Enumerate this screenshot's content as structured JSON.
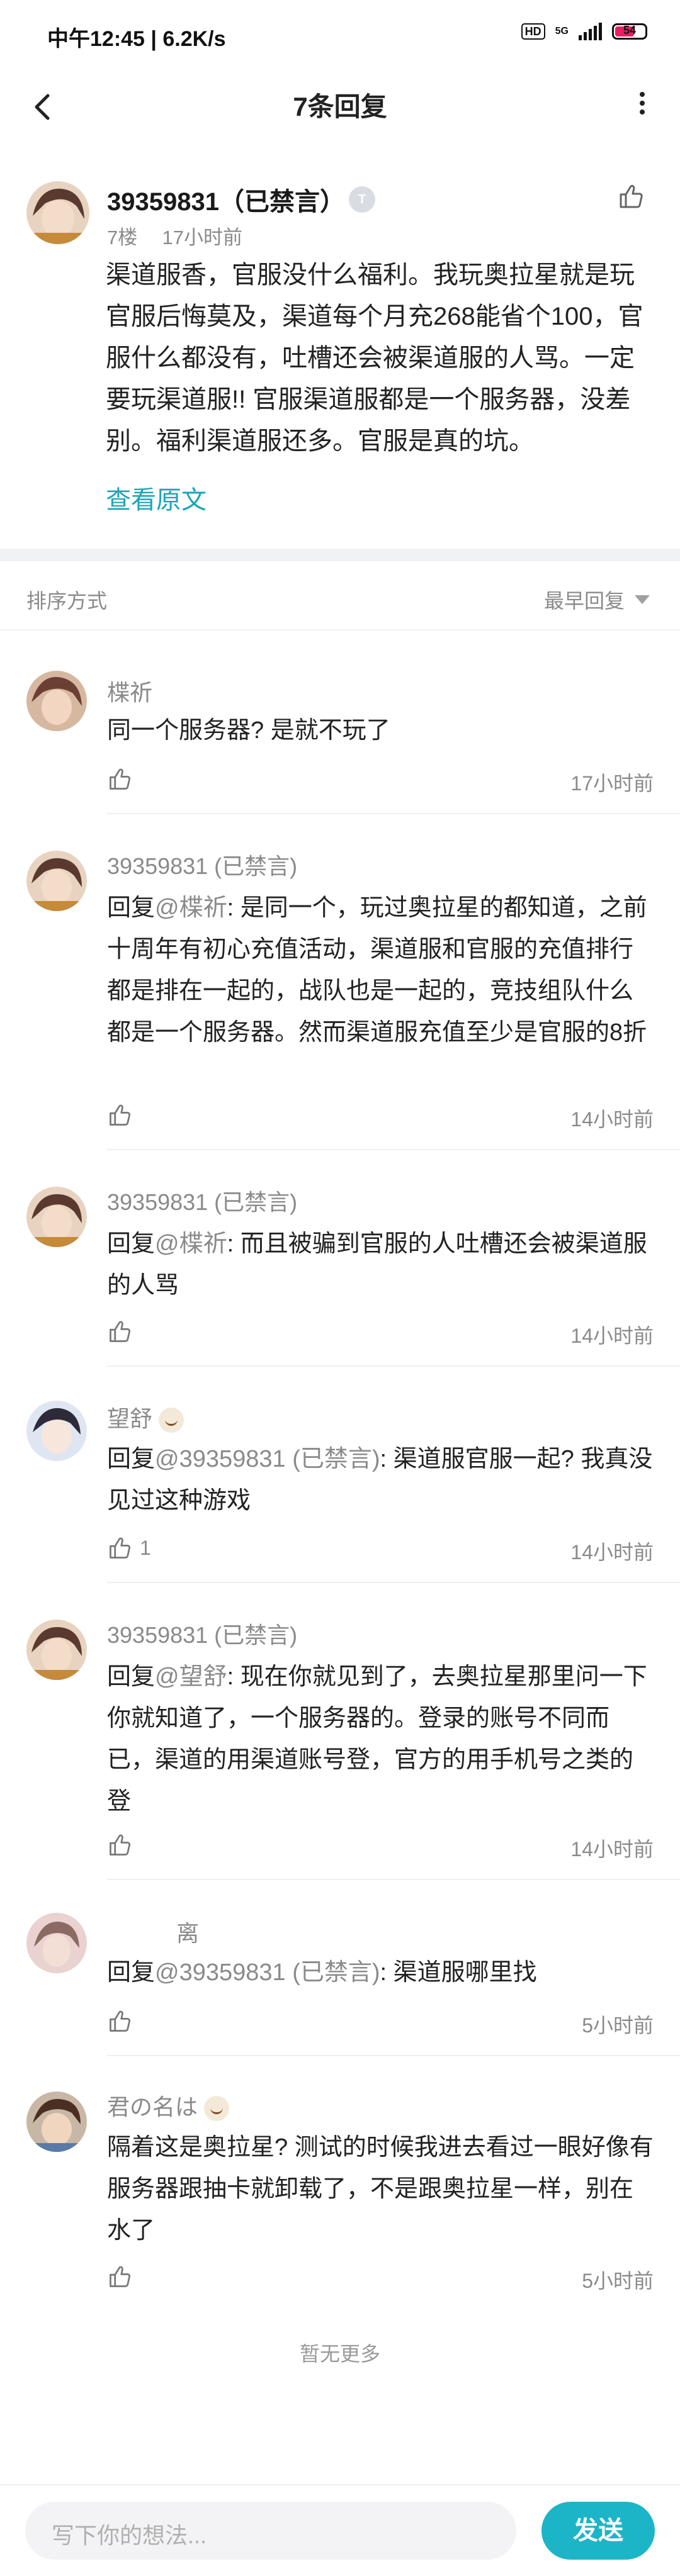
{
  "status_bar": {
    "time": "中午12:45 | 6.2K/s",
    "network": "5G",
    "hd": "HD",
    "battery": "54"
  },
  "header": {
    "title": "7条回复"
  },
  "post": {
    "author": "39359831（已禁言）",
    "badge": "T",
    "floor": "7楼",
    "time": "17小时前",
    "body": "渠道服香，官服没什么福利。我玩奥拉星就是玩官服后悔莫及，渠道每个月充268能省个100，官服什么都没有，吐槽还会被渠道服的人骂。一定要玩渠道服!! 官服渠道服都是一个服务器，没差别。福利渠道服还多。官服是真的坑。",
    "view_original": "查看原文"
  },
  "sort": {
    "label": "排序方式",
    "value": "最早回复"
  },
  "replies": [
    {
      "name": "楪祈",
      "prefix": "",
      "at": "",
      "text": "同一个服务器? 是就不玩了",
      "likes": "",
      "time": "17小时前"
    },
    {
      "name": "39359831 (已禁言)",
      "prefix": "回复",
      "at": "@楪祈",
      "text": ": 是同一个，玩过奥拉星的都知道，之前十周年有初心充值活动，渠道服和官服的充值排行都是排在一起的，战队也是一起的，竞技组队什么都是一个服务器。然而渠道服充值至少是官服的8折",
      "likes": "",
      "time": "14小时前"
    },
    {
      "name": "39359831 (已禁言)",
      "prefix": "回复",
      "at": "@楪祈",
      "text": ": 而且被骗到官服的人吐槽还会被渠道服的人骂",
      "likes": "",
      "time": "14小时前"
    },
    {
      "name": "望舒",
      "prefix": "回复",
      "at": "@39359831 (已禁言)",
      "text": ": 渠道服官服一起? 我真没见过这种游戏",
      "likes": "1",
      "time": "14小时前"
    },
    {
      "name": "39359831 (已禁言)",
      "prefix": "回复",
      "at": "@望舒",
      "text": ": 现在你就见到了，去奥拉星那里问一下你就知道了，一个服务器的。登录的账号不同而已，渠道的用渠道账号登，官方的用手机号之类的登",
      "likes": "",
      "time": "14小时前"
    },
    {
      "name": "离",
      "prefix": "回复",
      "at": "@39359831 (已禁言)",
      "text": ": 渠道服哪里找",
      "likes": "",
      "time": "5小时前"
    },
    {
      "name": "君の名は",
      "prefix": "",
      "at": "",
      "text": "隔着这是奥拉星? 测试的时候我进去看过一眼好像有服务器跟抽卡就卸载了，不是跟奥拉星一样，别在水了",
      "likes": "",
      "time": "5小时前"
    }
  ],
  "footer": {
    "no_more": "暂无更多",
    "input_placeholder": "写下你的想法...",
    "send": "发送"
  },
  "colors": {
    "accent": "#1cb5c7",
    "link": "#1aa6b7",
    "muted": "#8a8a8a"
  }
}
